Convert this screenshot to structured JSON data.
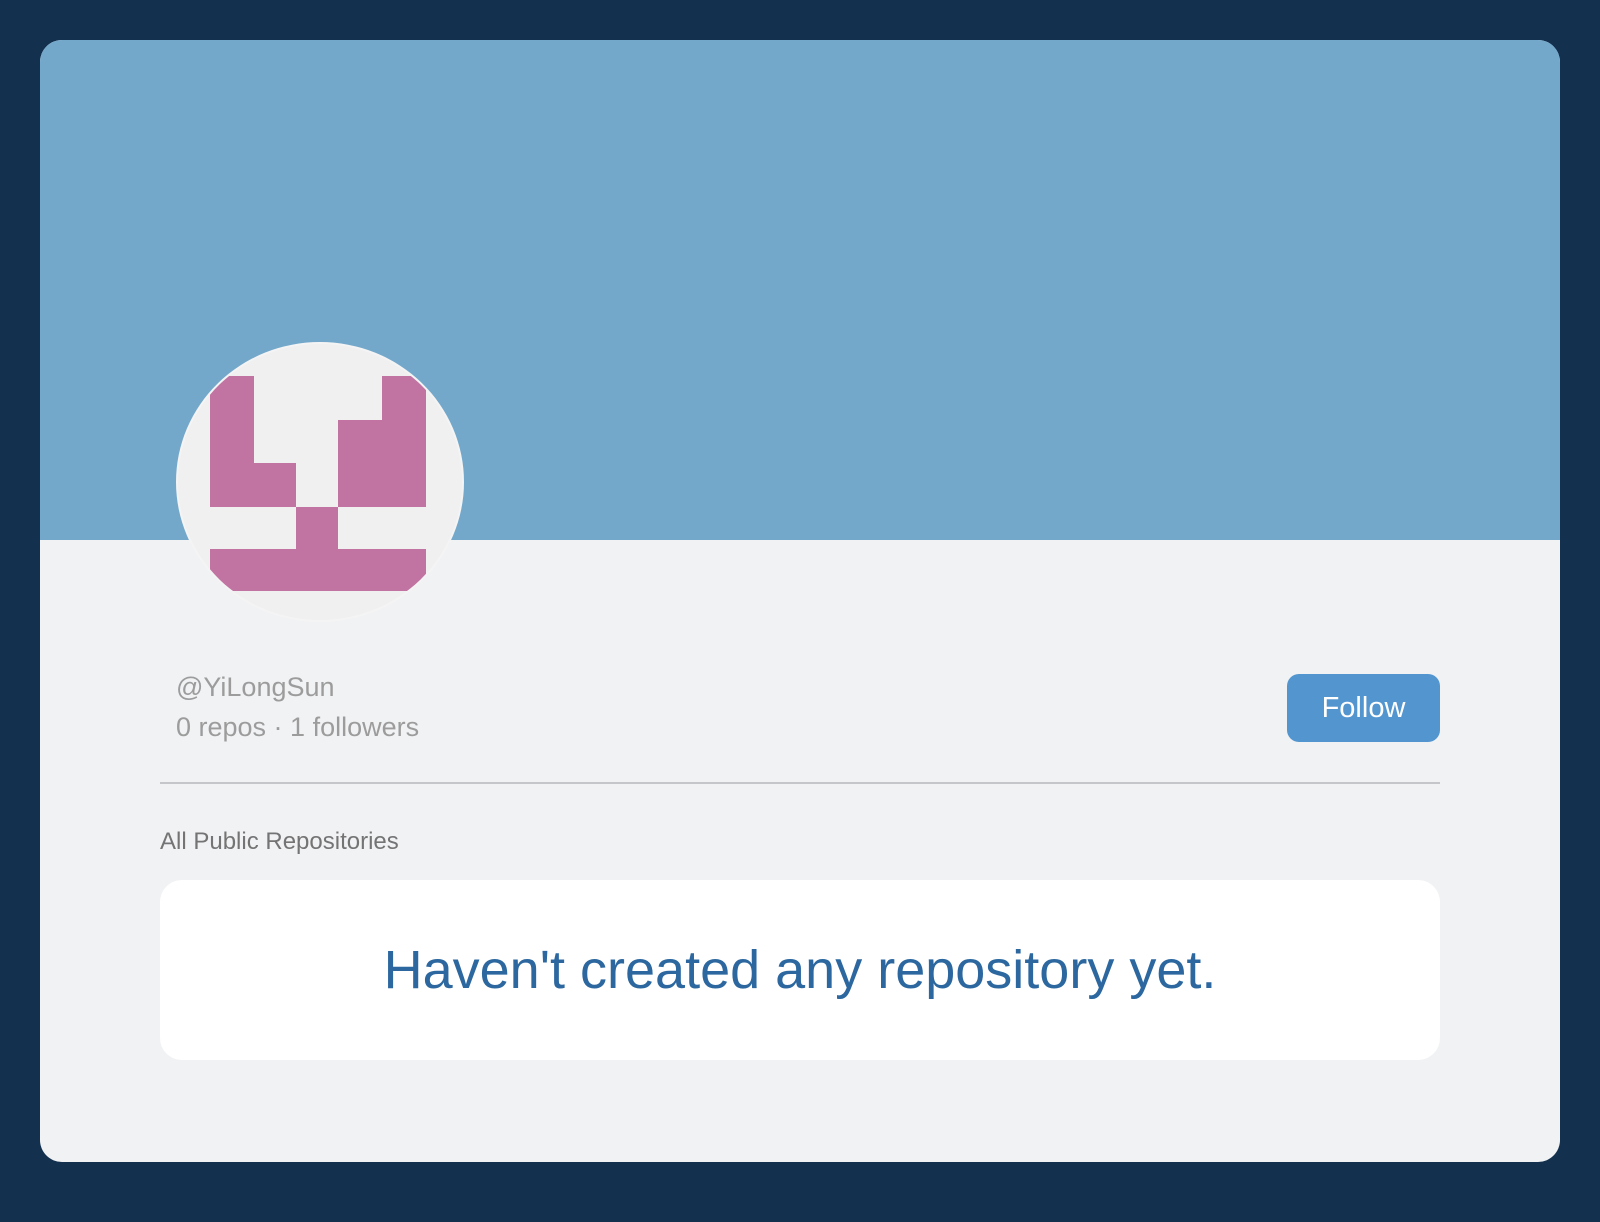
{
  "profile": {
    "username": "@YiLongSun",
    "stats": "0 repos · 1 followers",
    "follow_label": "Follow",
    "banner_color": "#73a8cb",
    "avatar_color": "#c174a2"
  },
  "repositories": {
    "section_label": "All Public Repositories",
    "empty_message": "Haven't created any repository yet."
  }
}
